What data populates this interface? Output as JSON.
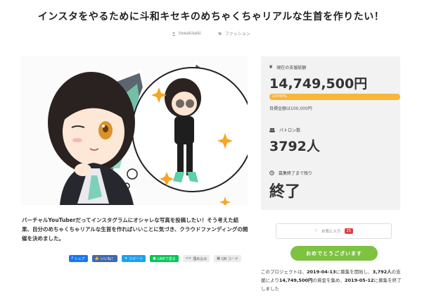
{
  "project": {
    "title": "インスタをやるために斗和キセキのめちゃくちゃリアルな生首を作りたい！",
    "owner": "towakiseki",
    "category": "ファッション"
  },
  "description": "バーチャルYouTuberだってインスタグラムにオシャレな写真を投稿したい！そう考えた結果、自分のめちゃくちゃリアルな生首を作ればいいことに気づき、クラウドファンディングの開催を決めました。",
  "share": {
    "facebook": "シェア",
    "like": "いいね！",
    "tweet": "ツイート",
    "line": "LINEで送る",
    "embed": "埋め込み",
    "qr": "QR コード"
  },
  "stats": {
    "funded_label": "現在の支援総額",
    "funded_value": "14,749,500円",
    "progress_text": "14749%",
    "progress_fraction": 1.0,
    "goal_text": "目標金額は100,000円",
    "backers_label": "パトロン数",
    "backers_value": "3792人",
    "remaining_label": "募集終了まで残り",
    "remaining_value": "終了"
  },
  "favorite": {
    "label": "お気に入り",
    "count": "25"
  },
  "congrats_label": "おめでとうございます",
  "summary": {
    "p1": "このプロジェクトは、",
    "start": "2019-04-13",
    "p2": "に募集を開始し、",
    "backers": "3,792人",
    "p3": "の支援により",
    "amount": "14,749,500円",
    "p4": "の資金を集め、",
    "end": "2019-05-12",
    "p5": "に募集を終了しました"
  },
  "colors": {
    "accent": "#f6b73c",
    "green": "#7dc241",
    "panel": "#f2f2f2"
  }
}
